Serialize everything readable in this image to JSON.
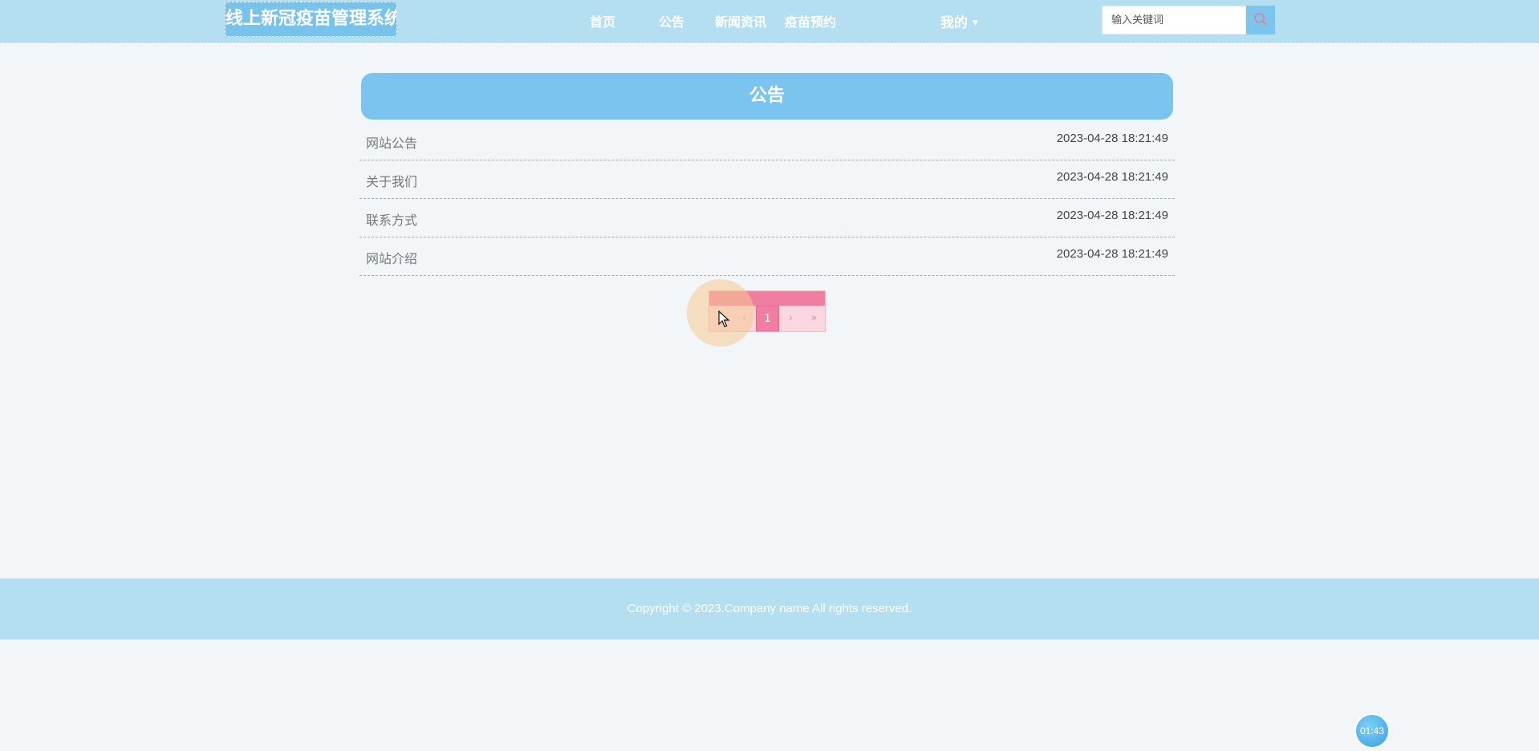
{
  "header": {
    "logo": "线上新冠疫苗管理系统",
    "nav": [
      "首页",
      "公告",
      "新闻资讯",
      "疫苗预约"
    ],
    "mine_label": "我的",
    "search_placeholder": "输入关键词"
  },
  "panel": {
    "title": "公告",
    "items": [
      {
        "title": "网站公告",
        "time": "2023-04-28 18:21:49"
      },
      {
        "title": "关于我们",
        "time": "2023-04-28 18:21:49"
      },
      {
        "title": "联系方式",
        "time": "2023-04-28 18:21:49"
      },
      {
        "title": "网站介绍",
        "time": "2023-04-28 18:21:49"
      }
    ]
  },
  "pagination": {
    "first": "«",
    "prev": "‹",
    "current": "1",
    "next": "›",
    "last": "»"
  },
  "footer": {
    "copyright": "Copyright © 2023.Company name All rights reserved."
  },
  "timer": "01:43",
  "colors": {
    "header_bg": "#b4dff1",
    "accent_blue": "#7ac4ef",
    "accent_pink": "#ef7ea2",
    "page_bg": "#f3f6f8"
  }
}
